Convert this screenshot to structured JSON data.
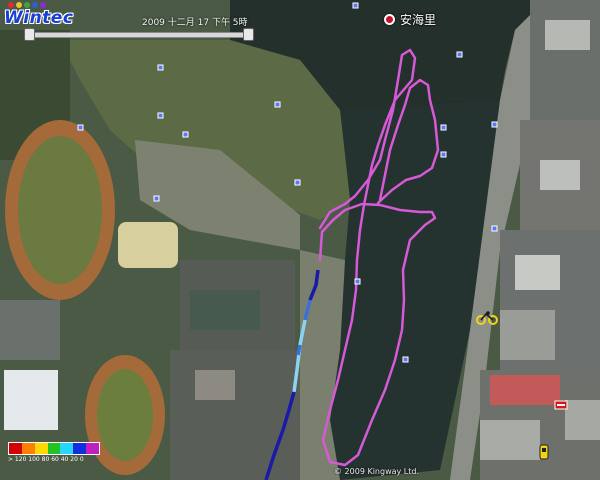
{
  "logo": {
    "text": "Wintec",
    "dot_colors": [
      "#e52b2b",
      "#f2c12e",
      "#3da545",
      "#2b5fd6",
      "#8a2bd6"
    ]
  },
  "timestamp": "2009 十二月 17 下午 5時",
  "place_label": "安海里",
  "legend": {
    "colors": [
      "#d40000",
      "#ff7f00",
      "#ffd800",
      "#22c322",
      "#25d6ff",
      "#1030e0",
      "#c020c0"
    ],
    "ticks": "> 120 100 80  60  40  20  0"
  },
  "copyright": "© 2009 Kingway Ltd.",
  "track_colors": {
    "main": "#d65ad6",
    "upper": "#1a1aa8",
    "middle": "#3b6fe0",
    "lower": "#8ad4f0"
  },
  "icons": {
    "waypoint": "waypoint-square-icon",
    "place_pin": "red-dot-pin-icon",
    "cyclist": "cyclist-icon",
    "flag": "red-flag-icon",
    "figure": "yellow-figure-icon"
  }
}
